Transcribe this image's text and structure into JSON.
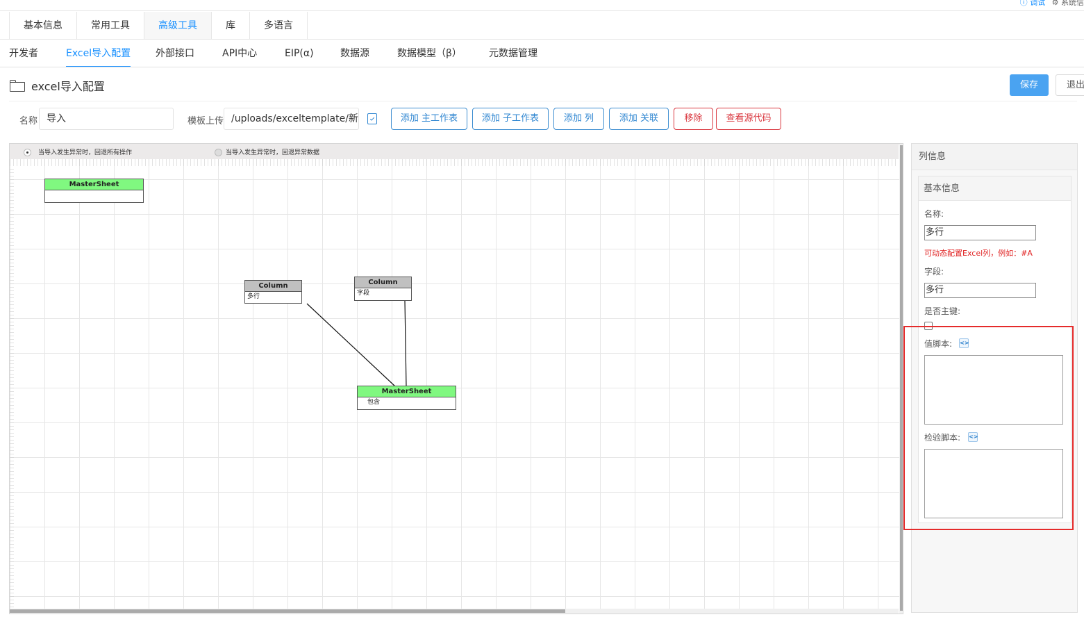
{
  "topbar": {
    "debug": "ⓘ 调试",
    "system": "⚙ 系统信"
  },
  "tabs_primary": [
    "基本信息",
    "常用工具",
    "高级工具",
    "库",
    "多语言"
  ],
  "tabs_secondary": [
    "开发者",
    "Excel导入配置",
    "外部接口",
    "API中心",
    "EIP(α)",
    "数据源",
    "数据模型（β）",
    "元数据管理"
  ],
  "page": {
    "title": "excel导入配置",
    "save_label": "保存",
    "exit_label": "退出"
  },
  "form": {
    "name_label": "名称",
    "name_value": "导入",
    "template_label": "模板上传",
    "template_value": "/uploads/exceltemplate/新建",
    "buttons": [
      "添加 主工作表",
      "添加 子工作表",
      "添加 列",
      "添加 关联",
      "移除",
      "查看源代码"
    ]
  },
  "canvas": {
    "radio1": "当导入发生异常时，回退所有操作",
    "radio2": "当导入发生异常时，回退异常数据",
    "nodes": [
      {
        "title": "MasterSheet",
        "body": ""
      },
      {
        "title": "Column",
        "body": "多行"
      },
      {
        "title": "Column",
        "body": "字段"
      },
      {
        "title": "MasterSheet",
        "body": "包含"
      }
    ]
  },
  "panel": {
    "title": "列信息",
    "section": "基本信息",
    "name_label": "名称:",
    "name_value": "多行",
    "hint": "可动态配置Excel列，例如：#A",
    "field_label": "字段:",
    "field_value": "多行",
    "pk_label": "是否主键:",
    "value_script_label": "值脚本:",
    "check_script_label": "检验脚本:",
    "code_icon": "<>"
  },
  "colors": {
    "accent": "#1890ff",
    "save_bg": "#4aa3f1",
    "danger": "#d9363e",
    "node_green": "#80f880",
    "node_gray": "#c0c0c0",
    "highlight": "#e52b2b"
  }
}
